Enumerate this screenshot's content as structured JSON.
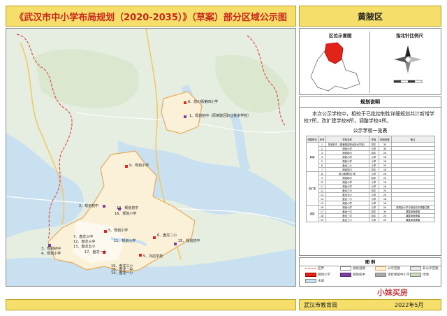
{
  "header": {
    "title": "《武汉市中小学布局规划（2020-2035）》（草案）部分区域公示图",
    "district": "黄陂区"
  },
  "panels": {
    "location_map_label": "区位示意图",
    "compass_label": "指北针比例尺"
  },
  "plan": {
    "heading": "规划说明",
    "description": "本次公示学校中，相较于已批控制性详细规划共计新增学校7所，改扩建学校8所，调整学校4所。",
    "table_title": "公示学校一览表",
    "columns": [
      "调整情况",
      "序号",
      "学校名称",
      "学段",
      "规划班数",
      "备注"
    ],
    "groups": [
      {
        "name": "新增",
        "rows": [
          [
            "1",
            "规划初中（原黄陂区职业技术学校）",
            "初中",
            "30",
            ""
          ],
          [
            "2",
            "规划小学",
            "小学",
            "30",
            ""
          ],
          [
            "3",
            "规划初中",
            "初中",
            "24",
            ""
          ],
          [
            "4",
            "规划小学",
            "小学",
            "18",
            ""
          ],
          [
            "5",
            "规划小学",
            "小学",
            "18",
            ""
          ],
          [
            "6",
            "盘龙二小",
            "小学",
            "24",
            ""
          ],
          [
            "7",
            "规划初中",
            "初中",
            "18",
            ""
          ]
        ]
      },
      {
        "name": "改扩建",
        "rows": [
          [
            "8",
            "前川街第四小学",
            "小学",
            "24",
            ""
          ],
          [
            "9",
            "规划初中",
            "初中",
            "24",
            ""
          ],
          [
            "10",
            "规划小学",
            "小学",
            "18",
            ""
          ],
          [
            "11",
            "规划小学",
            "小学",
            "18",
            ""
          ],
          [
            "12",
            "盘龙三中",
            "初中",
            "24",
            ""
          ],
          [
            "13",
            "盘龙五小",
            "小学",
            "24",
            ""
          ],
          [
            "14",
            "盘龙一小",
            "小学",
            "18",
            ""
          ],
          [
            "15",
            "规划小学",
            "小学",
            "18",
            ""
          ]
        ]
      },
      {
        "name": "调整",
        "rows": [
          [
            "16",
            "规划小学",
            "小学",
            "24",
            "原规划小学与规划初中调整位置"
          ],
          [
            "17",
            "盘龙一中",
            "初中",
            "30",
            "调整用地规模"
          ],
          [
            "18",
            "盘龙二中",
            "初中",
            "24",
            "调整用地规模"
          ],
          [
            "19",
            "盘龙三小",
            "小学",
            "24",
            "调整用地规模"
          ]
        ]
      }
    ]
  },
  "legend": {
    "heading": "图 例",
    "items": [
      "区界",
      "规划道路",
      "公示范围",
      "非公示范围",
      "规划小学",
      "规划初中",
      "现状保留中小学",
      "绿地",
      "水域"
    ]
  },
  "footer": {
    "org": "武汉市教育局",
    "date": "2022年5月"
  },
  "watermark": "小妹买房",
  "map_labels": {
    "n8": "8、前川街第四小学",
    "n1": "1、规划初中（原黄陂区职业技术学校）",
    "n9": "9、规划小学",
    "n2": "2、规划初中",
    "n10": "10、规划初中",
    "n16": "16、规划小学",
    "n5": "5、规划小学",
    "n7": "7、盘龙三中",
    "n12": "12、盘龙三中",
    "n13": "13、盘龙五小",
    "n6": "6、盘龙二小",
    "n3": "3、规划初中",
    "n4": "4、规划小学",
    "n17": "17、盘龙一小",
    "n19": "19、盘龙三小",
    "n18": "18、盘龙二中",
    "n14": "14、盘龙一小",
    "n11": "11、规划小学",
    "n15": "15、规划初中",
    "n20": "5、刘店学校",
    "n21": "10、规划初中"
  }
}
